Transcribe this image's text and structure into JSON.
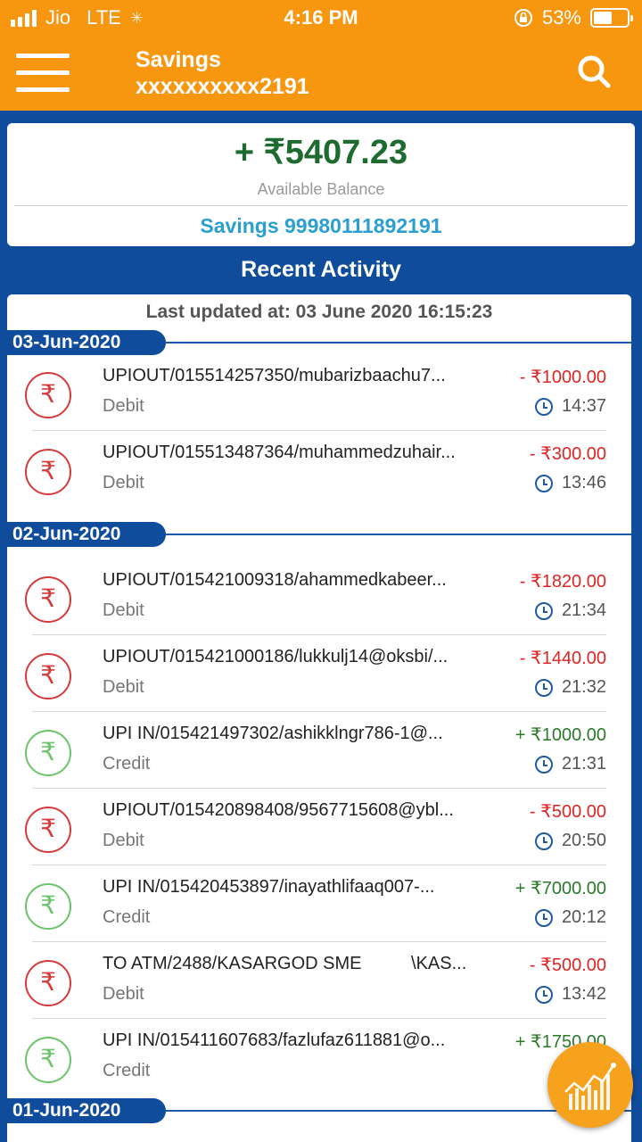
{
  "status_bar": {
    "carrier": "Jio",
    "network": "LTE",
    "time": "4:16 PM",
    "battery": "53%"
  },
  "app_bar": {
    "account_title": "Savings",
    "account_number_masked": "xxxxxxxxxx2191",
    "menu_icon": "hamburger-menu-icon",
    "search_icon": "search-icon"
  },
  "balance": {
    "amount": "+ ₹5407.23",
    "label": "Available Balance",
    "account": "Savings 99980111892191"
  },
  "recent": {
    "title": "Recent Activity",
    "last_updated": "Last updated at: 03 June 2020 16:15:23",
    "groups": [
      {
        "date": "03-Jun-2020",
        "transactions": [
          {
            "desc": "UPIOUT/015514257350/mubarizbaachu7...",
            "type": "Debit",
            "amount": "- ₹1000.00",
            "time": "14:37"
          },
          {
            "desc": "UPIOUT/015513487364/muhammedzuhair...",
            "type": "Debit",
            "amount": "- ₹300.00",
            "time": "13:46"
          }
        ]
      },
      {
        "date": "02-Jun-2020",
        "transactions": [
          {
            "desc": "UPIOUT/015421009318/ahammedkabeer...",
            "type": "Debit",
            "amount": "- ₹1820.00",
            "time": "21:34"
          },
          {
            "desc": "UPIOUT/015421000186/lukkulj14@oksbi/...",
            "type": "Debit",
            "amount": "- ₹1440.00",
            "time": "21:32"
          },
          {
            "desc": "UPI IN/015421497302/ashikklngr786-1@...",
            "type": "Credit",
            "amount": "+ ₹1000.00",
            "time": "21:31"
          },
          {
            "desc": "UPIOUT/015420898408/9567715608@ybl...",
            "type": "Debit",
            "amount": "- ₹500.00",
            "time": "20:50"
          },
          {
            "desc": "UPI IN/015420453897/inayathlifaaq007-...",
            "type": "Credit",
            "amount": "+ ₹7000.00",
            "time": "20:12"
          },
          {
            "desc": "TO ATM/2488/KASARGOD SME          \\KAS...",
            "type": "Debit",
            "amount": "- ₹500.00",
            "time": "13:42"
          },
          {
            "desc": "UPI IN/015411607683/fazlufaz611881@o...",
            "type": "Credit",
            "amount": "+ ₹1750.00",
            "time": ""
          }
        ]
      },
      {
        "date": "01-Jun-2020",
        "transactions": []
      }
    ]
  },
  "colors": {
    "orange": "#f7960f",
    "navy": "#0f4c9c",
    "debit": "#e02424",
    "credit": "#2a7a2a",
    "balance_green": "#1e6b30",
    "account_blue": "#2a9fd0"
  },
  "fab": {
    "icon": "analytics-chart-icon"
  }
}
